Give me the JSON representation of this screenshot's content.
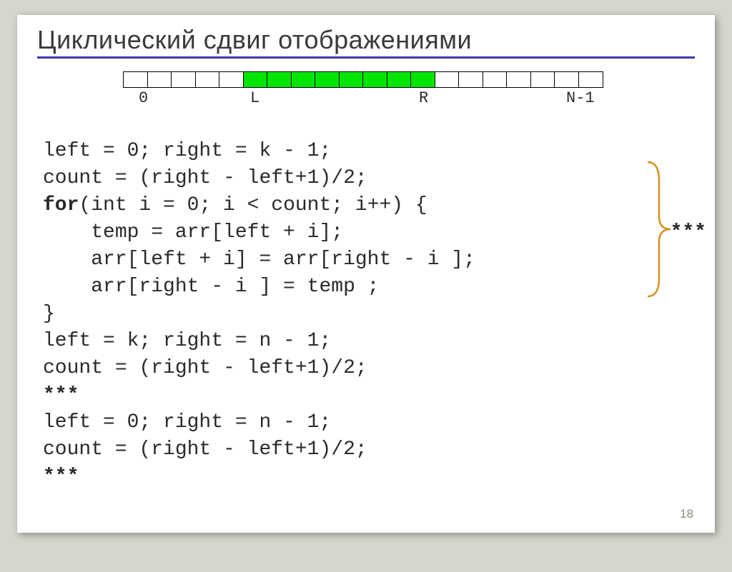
{
  "title": "Циклический сдвиг отображениями",
  "array": {
    "cells": 20,
    "filled_start": 5,
    "filled_end": 12,
    "labels": {
      "zero": "0",
      "L": "L",
      "R": "R",
      "N1": "N-1"
    }
  },
  "code": {
    "l1": "left = 0; right = k - 1;",
    "l2": "count = (right - left+1)/2;",
    "l3a": "for",
    "l3b": "(int i = 0; i < count; i++) {",
    "l4": "    temp = arr[left + i];",
    "l5": "    arr[left + i] = arr[right - i ];",
    "l6": "    arr[right - i ] = temp ;",
    "l7": "}",
    "l8": "left = k; right = n - 1;",
    "l9": "count = (right - left+1)/2;",
    "l10": "***",
    "l11": "left = 0; right = n - 1;",
    "l12": "count = (right - left+1)/2;",
    "l13": "***"
  },
  "side_stars": "***",
  "page_number": "18"
}
